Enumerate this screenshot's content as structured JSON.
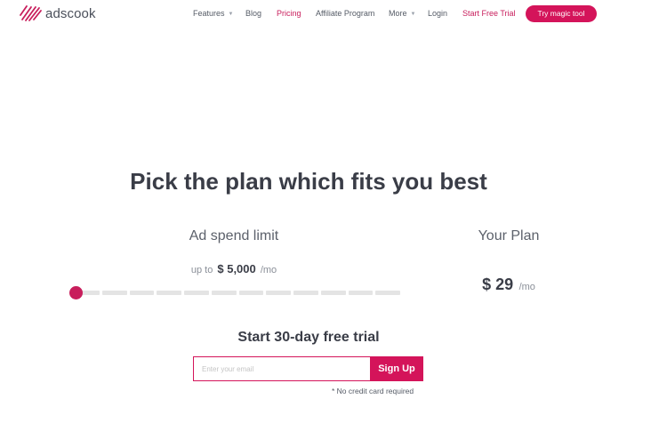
{
  "brand": {
    "name": "adscook",
    "accent_color": "#d4145a"
  },
  "nav": {
    "features": "Features",
    "blog": "Blog",
    "pricing": "Pricing",
    "affiliate": "Affiliate Program",
    "more": "More",
    "login": "Login",
    "start_trial": "Start Free Trial",
    "cta": "Try magic tool",
    "dropdown_icon": "chevron-down-icon"
  },
  "pricing": {
    "headline": "Pick the plan which fits you best",
    "ad_spend": {
      "title": "Ad spend limit",
      "prefix": "up to",
      "amount": "$ 5,000",
      "suffix": "/mo",
      "slider_value": 0,
      "slider_segments": 12
    },
    "plan": {
      "title": "Your Plan",
      "price": "$ 29",
      "per": "/mo"
    }
  },
  "trial": {
    "title": "Start 30-day free trial",
    "email_placeholder": "Enter your email",
    "email_value": "",
    "signup_label": "Sign Up",
    "note": "* No credit card required"
  }
}
